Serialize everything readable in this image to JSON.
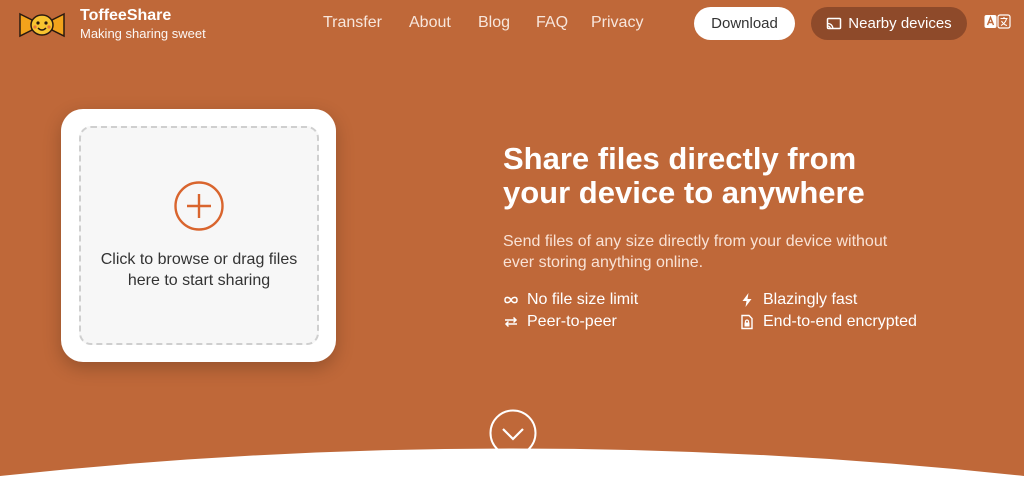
{
  "header": {
    "brand_name": "ToffeeShare",
    "brand_tagline": "Making sharing sweet",
    "nav": [
      "Transfer",
      "About",
      "Blog",
      "FAQ",
      "Privacy"
    ],
    "download_label": "Download",
    "nearby_label": "Nearby devices"
  },
  "dropzone": {
    "line1": "Click to browse or drag files",
    "line2": "here to start sharing"
  },
  "hero": {
    "headline_line1": "Share files directly from",
    "headline_line2": "your device to anywhere",
    "sub_line1": "Send files of any size directly from your device without",
    "sub_line2": "ever storing anything online.",
    "features": [
      "No file size limit",
      "Blazingly fast",
      "Peer-to-peer",
      "End-to-end encrypted"
    ]
  },
  "colors": {
    "hero_bg": "#bf6839",
    "accent": "#d9652e",
    "nearby_button": "#8e4a2a"
  },
  "icons": [
    "candy-logo-icon",
    "cast-icon",
    "translate-icon",
    "plus-circle-icon",
    "infinity-icon",
    "bolt-icon",
    "swap-arrows-icon",
    "lock-file-icon",
    "chevron-down-icon"
  ]
}
